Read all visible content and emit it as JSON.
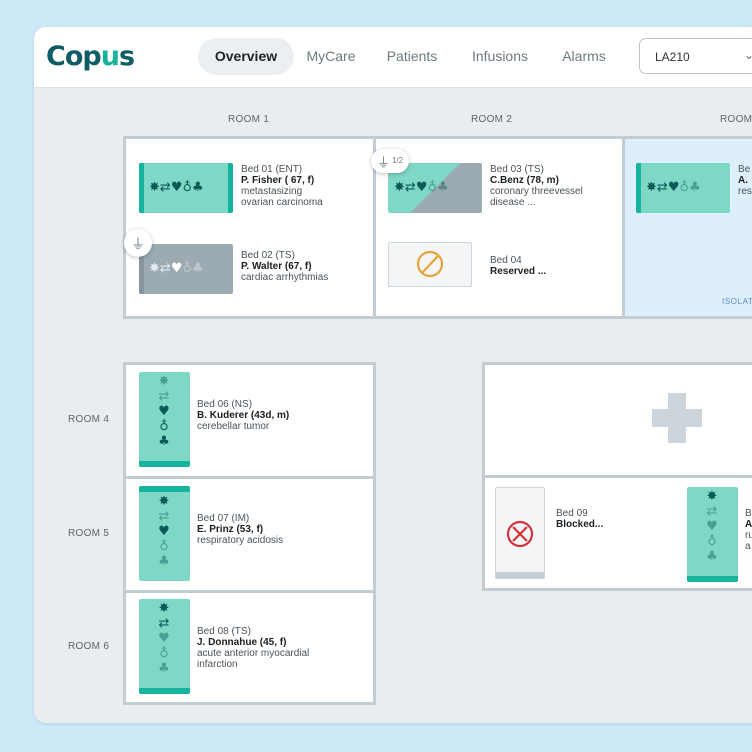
{
  "app": {
    "logo_prefix": "C",
    "logo_o": "o",
    "logo_p": "p",
    "logo_u": "u",
    "logo_s": "s"
  },
  "nav": {
    "tabs": [
      {
        "label": "Overview",
        "active": true
      },
      {
        "label": "MyCare"
      },
      {
        "label": "Patients"
      },
      {
        "label": "Infusions"
      },
      {
        "label": "Alarms"
      }
    ],
    "unit_select": {
      "value": "LA210",
      "chevron": "⌄"
    }
  },
  "rooms_top": [
    "ROOM 1",
    "ROOM 2",
    "ROOM"
  ],
  "rooms_left": [
    "ROOM 4",
    "ROOM 5",
    "ROOM 6"
  ],
  "isolation_label": "ISOLAT",
  "badge_count": "1/2",
  "icons": {
    "set": [
      "virus-icon",
      "arrows-icon",
      "heart-icon",
      "drop-icon",
      "lungs-icon"
    ],
    "glyphs": [
      "✸",
      "⇄",
      "♥",
      "♁",
      "♣"
    ]
  },
  "beds": [
    {
      "id": "Bed 01 (ENT)",
      "name": "P. Fisher ( 67, f)",
      "diag1": "metastasizing",
      "diag2": "ovarian carcinoma"
    },
    {
      "id": "Bed 02 (TS)",
      "name": "P. Walter (67, f)",
      "diag1": "cardiac arrhythmias",
      "diag2": ""
    },
    {
      "id": "Bed 03 (TS)",
      "name": "C.Benz (78, m)",
      "diag1": "coronary threevessel",
      "diag2": "disease ..."
    },
    {
      "id": "Bed 04",
      "name": "Reserved ...",
      "diag1": "",
      "diag2": ""
    },
    {
      "id": "Be",
      "name": "A.",
      "diag1": "res",
      "diag2": ""
    },
    {
      "id": "Bed 06 (NS)",
      "name": "B. Kuderer (43d, m)",
      "diag1": "cerebellar tumor",
      "diag2": ""
    },
    {
      "id": "Bed 07 (IM)",
      "name": "E. Prinz (53, f)",
      "diag1": "respiratory acidosis",
      "diag2": ""
    },
    {
      "id": "Bed 08 (TS)",
      "name": "J. Donnahue (45, f)",
      "diag1": "acute anterior myocardial",
      "diag2": "infarction"
    },
    {
      "id": "Bed 09",
      "name": "Blocked...",
      "diag1": "",
      "diag2": ""
    },
    {
      "id": "B",
      "name": "A",
      "diag1": "ru",
      "diag2": "a"
    }
  ],
  "colors": {
    "teal": "#7fd7c5",
    "teal_stripe": "#16b49c",
    "grey": "#9cabb2",
    "reserved": "#e3a43a",
    "blocked": "#d0333b",
    "isolation": "#ddeefc"
  }
}
